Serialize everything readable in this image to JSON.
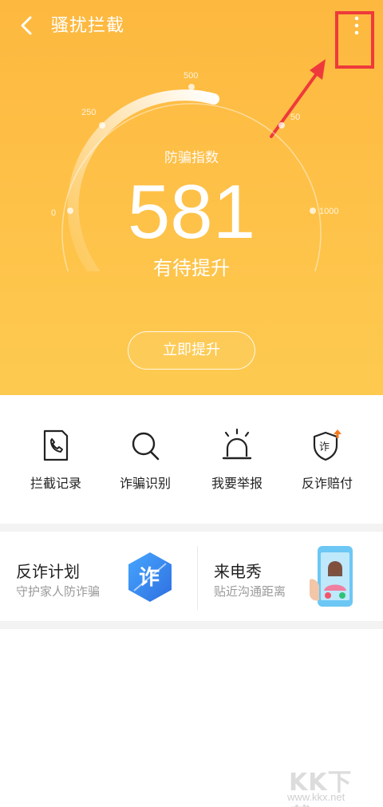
{
  "header": {
    "title": "骚扰拦截",
    "back_icon": "chevron-left-icon",
    "more_icon": "more-vertical-icon"
  },
  "gauge": {
    "caption": "防骗指数",
    "score": "581",
    "status": "有待提升",
    "ticks": [
      "0",
      "250",
      "500",
      "750",
      "1000"
    ],
    "tick_display": [
      "0",
      "250",
      "500",
      "50",
      "1000"
    ],
    "min": 0,
    "max": 1000,
    "value": 581
  },
  "boost_button": {
    "label": "立即提升"
  },
  "quick_actions": [
    {
      "label": "拦截记录",
      "icon": "call-log-icon"
    },
    {
      "label": "诈骗识别",
      "icon": "search-icon"
    },
    {
      "label": "我要举报",
      "icon": "alarm-light-icon"
    },
    {
      "label": "反诈赔付",
      "icon": "shield-icon",
      "icon_text": "诈"
    }
  ],
  "cards": [
    {
      "title": "反诈计划",
      "subtitle": "守护家人防诈骗",
      "icon": "anti-fraud-hexagon-icon",
      "icon_text": "诈"
    },
    {
      "title": "来电秀",
      "subtitle": "贴近沟通距离",
      "icon": "phone-caller-illustration-icon"
    }
  ],
  "watermark": {
    "logo": "KK下载",
    "url": "www.kkx.net"
  },
  "colors": {
    "header_gradient_top": "#fdb83f",
    "header_gradient_bottom": "#fdca4f",
    "highlight_red": "#ee3a3a",
    "hexagon_blue": "#3e8ff0"
  }
}
